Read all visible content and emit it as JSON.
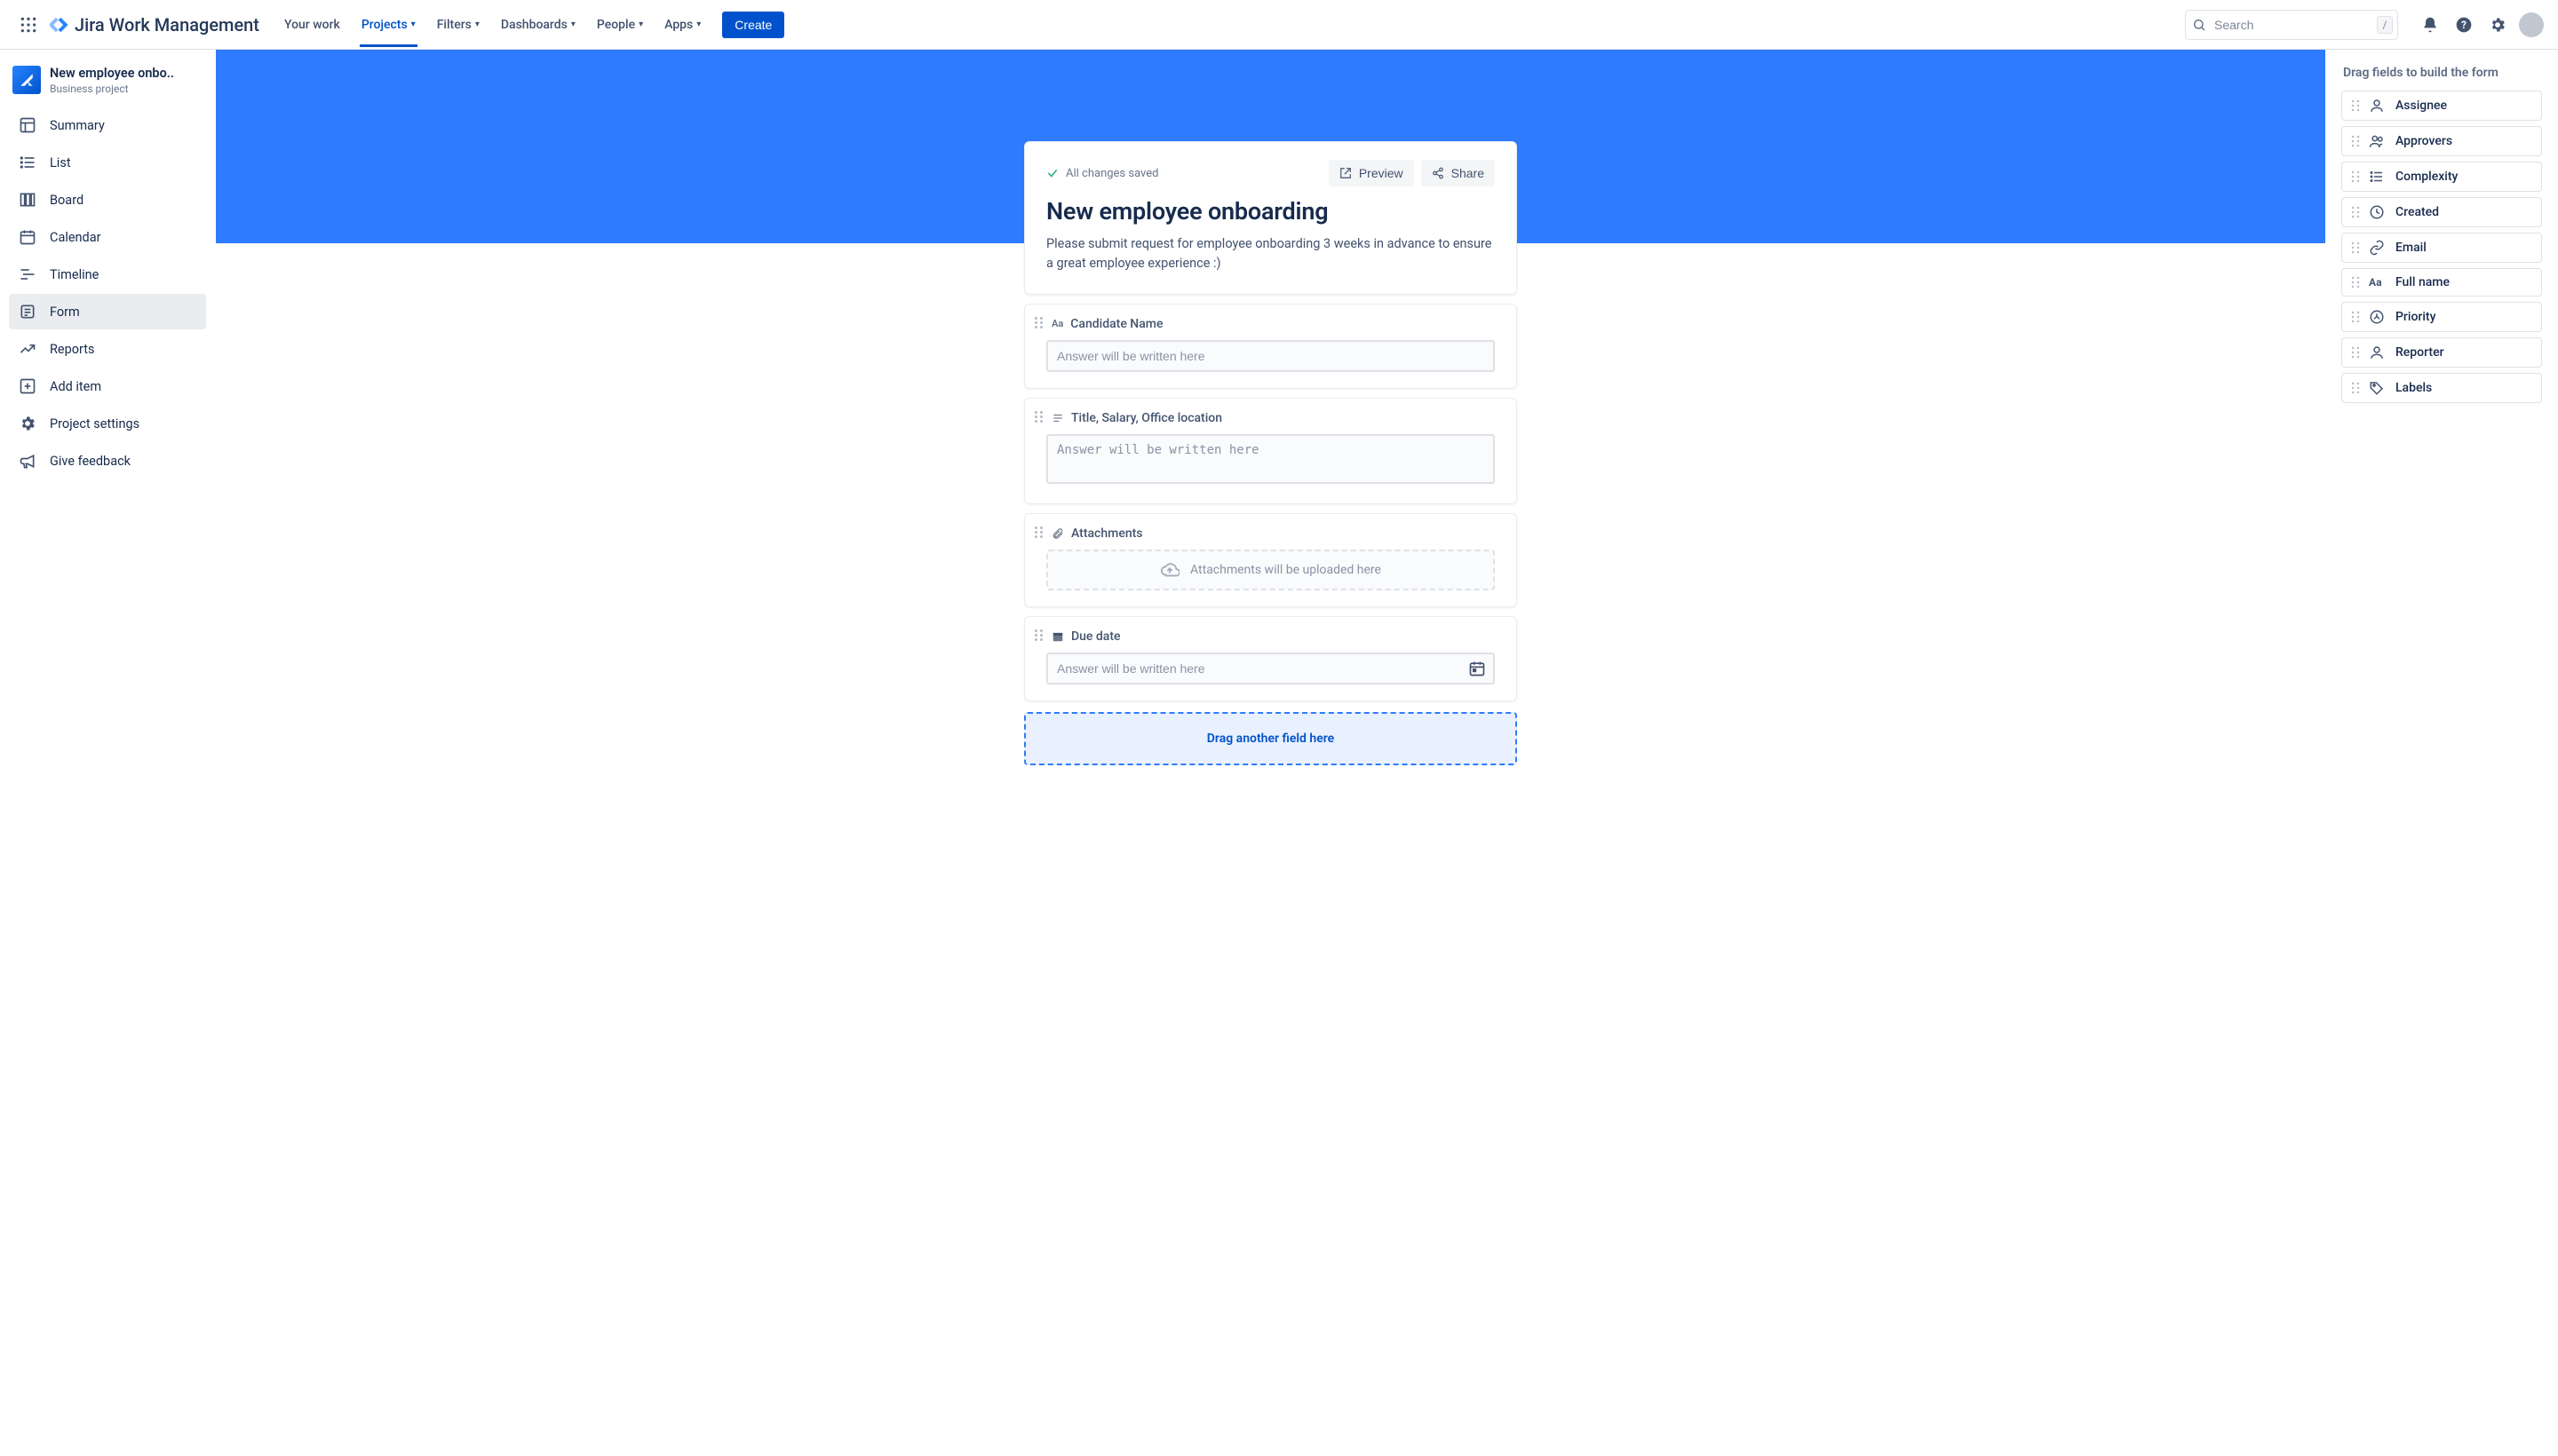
{
  "topnav": {
    "product": "Jira Work Management",
    "items": [
      {
        "label": "Your work",
        "dropdown": false
      },
      {
        "label": "Projects",
        "dropdown": true,
        "active": true
      },
      {
        "label": "Filters",
        "dropdown": true
      },
      {
        "label": "Dashboards",
        "dropdown": true
      },
      {
        "label": "People",
        "dropdown": true
      },
      {
        "label": "Apps",
        "dropdown": true
      }
    ],
    "create": "Create",
    "search_placeholder": "Search",
    "slash": "/"
  },
  "sidebar": {
    "project_name": "New employee onbo..",
    "project_type": "Business project",
    "items": [
      {
        "label": "Summary",
        "icon": "summary"
      },
      {
        "label": "List",
        "icon": "list"
      },
      {
        "label": "Board",
        "icon": "board"
      },
      {
        "label": "Calendar",
        "icon": "calendar"
      },
      {
        "label": "Timeline",
        "icon": "timeline"
      },
      {
        "label": "Form",
        "icon": "form",
        "selected": true
      },
      {
        "label": "Reports",
        "icon": "reports"
      },
      {
        "label": "Add item",
        "icon": "add"
      },
      {
        "label": "Project settings",
        "icon": "gear"
      },
      {
        "label": "Give feedback",
        "icon": "megaphone"
      }
    ]
  },
  "form": {
    "saved_text": "All changes saved",
    "preview": "Preview",
    "share": "Share",
    "title": "New employee onboarding",
    "description": "Please submit request for employee onboarding 3 weeks in advance to ensure a great employee experience :)",
    "placeholder_text": "Answer will be written here",
    "attach_placeholder": "Attachments will be uploaded here",
    "fields": [
      {
        "label": "Candidate Name",
        "type": "short_text"
      },
      {
        "label": "Title, Salary, Office location",
        "type": "paragraph"
      },
      {
        "label": "Attachments",
        "type": "attachments"
      },
      {
        "label": "Due date",
        "type": "date"
      }
    ],
    "dropzone": "Drag another field here"
  },
  "right_panel": {
    "title": "Drag fields to build the form",
    "fields": [
      {
        "label": "Assignee",
        "icon": "person"
      },
      {
        "label": "Approvers",
        "icon": "people"
      },
      {
        "label": "Complexity",
        "icon": "list"
      },
      {
        "label": "Created",
        "icon": "clock"
      },
      {
        "label": "Email",
        "icon": "link"
      },
      {
        "label": "Full name",
        "icon": "text"
      },
      {
        "label": "Priority",
        "icon": "priority"
      },
      {
        "label": "Reporter",
        "icon": "person"
      },
      {
        "label": "Labels",
        "icon": "tag"
      }
    ]
  }
}
